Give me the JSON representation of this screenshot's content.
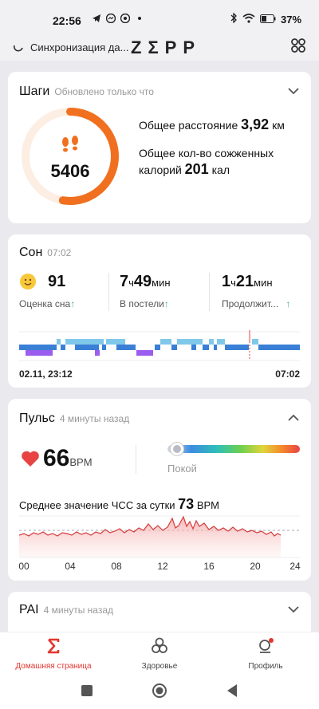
{
  "status": {
    "time": "22:56",
    "battery": "37"
  },
  "header": {
    "sync_text": "Синхронизация да...",
    "logo": "ΖΣΡΡ"
  },
  "steps": {
    "title": "Шаги",
    "updated": "Обновлено только что",
    "value": "5406",
    "distance_label": "Общее расстояние",
    "distance_value": "3,92",
    "distance_unit": "км",
    "calories_label_1": "Общее кол-во сожженных",
    "calories_label_2": "калорий",
    "calories_value": "201",
    "calories_unit": "кал"
  },
  "sleep": {
    "title": "Сон",
    "time": "07:02",
    "score": "91",
    "score_label": "Оценка сна",
    "in_bed_h": "7",
    "in_bed_m": "49",
    "h_unit": "ч",
    "m_unit": "мин",
    "in_bed_label": "В постели",
    "dur_h": "1",
    "dur_m": "21",
    "dur_label": "Продолжит...",
    "start": "02.11, 23:12",
    "end": "07:02"
  },
  "pulse": {
    "title": "Пульс",
    "updated": "4 минуты назад",
    "value": "66",
    "unit": "BPM",
    "zone": "Покой",
    "avg_label": "Среднее значение ЧСС за сутки",
    "avg_value": "73",
    "avg_unit": "BPM",
    "ticks": [
      "00",
      "04",
      "08",
      "12",
      "16",
      "20",
      "24"
    ]
  },
  "pai": {
    "title": "PAI",
    "updated": "4 минуты назад"
  },
  "nav": {
    "home": "Домашняя страница",
    "health": "Здоровье",
    "profile": "Профиль"
  },
  "colors": {
    "accent": "#f07020",
    "red": "#e2362f",
    "light_sleep": "#7fc8ea",
    "deep_sleep": "#3a7fd6",
    "rem": "#9b5cf0"
  }
}
